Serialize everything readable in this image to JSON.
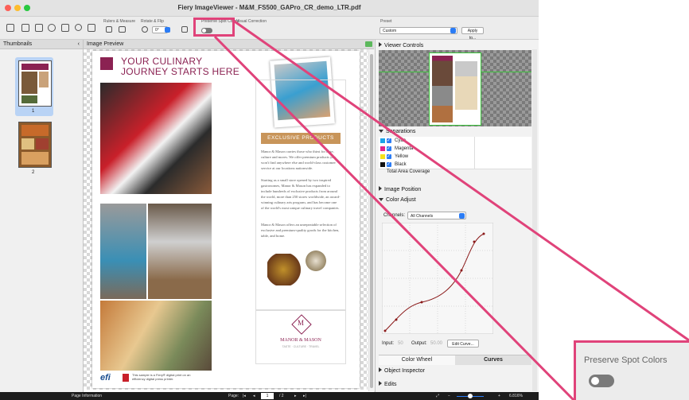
{
  "window": {
    "title": "Fiery ImageViewer - M&M_FS500_GAPro_CR_demo_LTR.pdf",
    "colors": {
      "accent": "#2b7cf5",
      "highlight": "#e0437a",
      "brand": "#8b2252"
    }
  },
  "toolbar": {
    "group_labels": {
      "rulers": "Rulers & Measure",
      "rotate": "Rotate & Flip",
      "preserve": "Preserve Spot Colors",
      "visual": "Visual Correction"
    },
    "rotate_value": "0°",
    "preset_label": "Preset",
    "preset_value": "Custom",
    "apply_label": "Apply to..."
  },
  "thumbnails": {
    "title": "Thumbnails",
    "pages": [
      "1",
      "2"
    ]
  },
  "preview": {
    "title": "Image Preview",
    "page": {
      "headline1": "YOUR CULINARY",
      "headline2": "JOURNEY STARTS HERE",
      "banner": "EXCLUSIVE PRODUCTS",
      "para1": "Manor & Mason carries those who thirst for taste, culture and mores. We offer premium products you won't find anywhere else and world-class customer service at our locations nationwide.",
      "para2": "Starting as a small store opened by two inspired gastronomes, Manor & Mason has expanded to include hundreds of exclusive products from around the world, more than 250 stores worldwide, an award-winning culinary arts program, and has become one of the world's most unique culinary travel companies.",
      "para3": "Manor & Mason offers an unrepeatable selection of exclusive and premium-quality goods for the kitchen, table, and home.",
      "logo_letter": "M",
      "logo_name": "MANOR & MASON",
      "logo_tag": "TASTE · CULTURE · TRAVEL",
      "efi": "efi",
      "efi_note1": "This sample is a Fiery® digital print on an",
      "efi_note2": "efficiency digital press printer."
    }
  },
  "right_panel": {
    "viewer_controls": "Viewer Controls",
    "separations": "Separations",
    "seps": [
      {
        "name": "Cyan",
        "color": "#1aa3e8"
      },
      {
        "name": "Magenta",
        "color": "#e0238a"
      },
      {
        "name": "Yellow",
        "color": "#f5e11b"
      },
      {
        "name": "Black",
        "color": "#111111"
      }
    ],
    "total_area": "Total Area Coverage",
    "image_position": "Image Position",
    "color_adjust": "Color Adjust",
    "channels_label": "Channels:",
    "channels_value": "All Channels",
    "input_label": "Input:",
    "input_value": "50",
    "output_label": "Output:",
    "output_value": "50.00",
    "edit_curve": "Edit Curve...",
    "tab_wheel": "Color Wheel",
    "tab_curves": "Curves",
    "object_inspector": "Object Inspector",
    "edits": "Edits"
  },
  "status": {
    "page_info": "Page Information",
    "page_label": "Page:",
    "page_value": "1",
    "page_total": "/ 2",
    "zoom": "6.816%"
  },
  "callout": {
    "label": "Preserve Spot Colors"
  }
}
